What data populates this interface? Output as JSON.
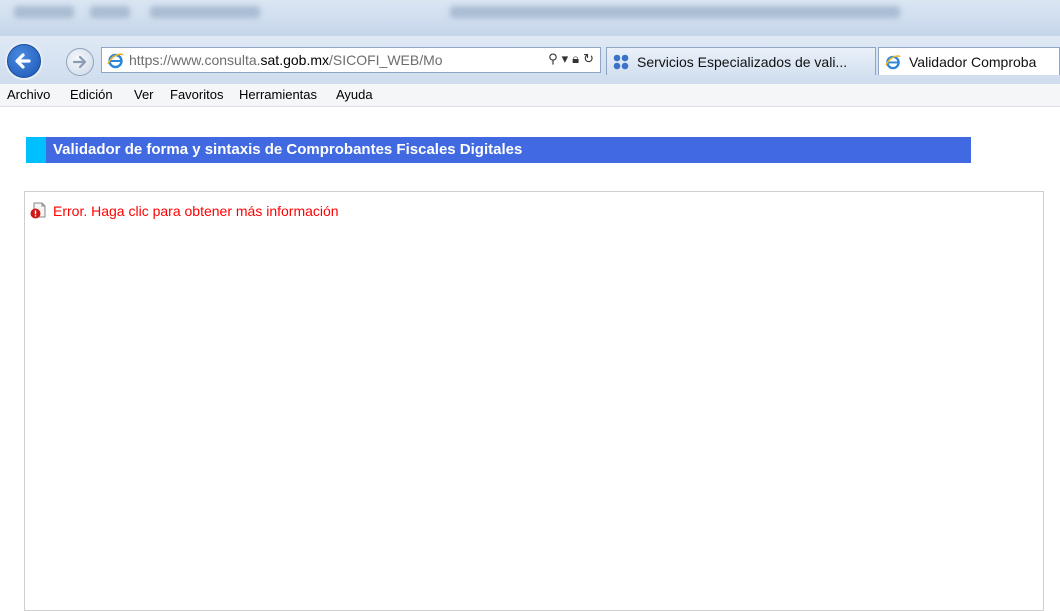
{
  "browser": {
    "address_bar": {
      "url_prefix": "https://www.consulta.",
      "url_host": "sat.gob.mx",
      "url_suffix": "/SICOFI_WEB/Mo"
    },
    "tabs": [
      {
        "label": "Servicios Especializados de vali...",
        "icon": "grid-icon"
      },
      {
        "label": "Validador Comproba",
        "icon": "ie-icon"
      }
    ],
    "menu": [
      "Archivo",
      "Edición",
      "Ver",
      "Favoritos",
      "Herramientas",
      "Ayuda"
    ]
  },
  "page": {
    "banner_title": "Validador de forma y sintaxis de Comprobantes Fiscales Digitales",
    "error_message": "Error. Haga clic para obtener más información"
  },
  "colors": {
    "banner": "#4169e1",
    "banner_accent": "#00bfff",
    "error_text": "#ff0000"
  }
}
